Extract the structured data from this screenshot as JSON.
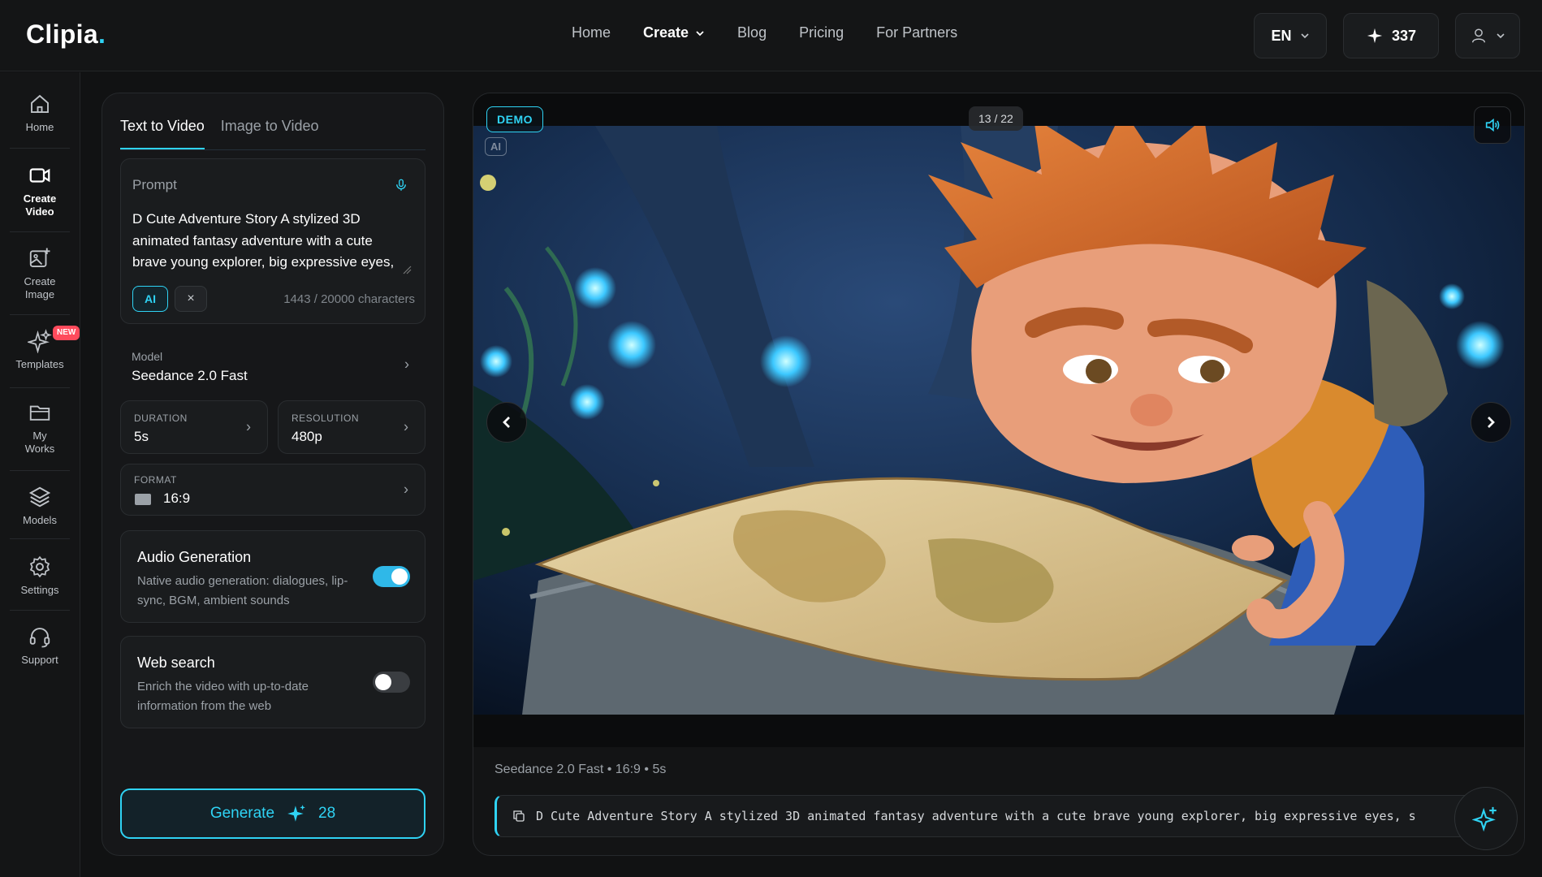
{
  "app": {
    "logo": "Clipia",
    "logo_dot": "."
  },
  "nav": {
    "items": [
      "Home",
      "Blog",
      "Pricing",
      "For Partners"
    ],
    "create_label": "Create"
  },
  "header": {
    "language": "EN",
    "credits": "337"
  },
  "sidebar": {
    "items": [
      {
        "label": "Home",
        "icon": "home-icon"
      },
      {
        "label": "Create\nVideo",
        "icon": "video-camera-icon"
      },
      {
        "label": "Create\nImage",
        "icon": "image-plus-icon"
      },
      {
        "label": "Templates",
        "icon": "sparkle-icon",
        "badge": "NEW"
      },
      {
        "label": "My\nWorks",
        "icon": "folder-icon"
      },
      {
        "label": "Models",
        "icon": "layers-icon"
      },
      {
        "label": "Settings",
        "icon": "gear-icon"
      },
      {
        "label": "Support",
        "icon": "headset-icon"
      }
    ]
  },
  "panel": {
    "tabs": [
      "Text to Video",
      "Image to Video"
    ],
    "prompt": {
      "label": "Prompt",
      "text": "D Cute Adventure Story A stylized 3D animated fantasy adventure with a cute brave young explorer, big expressive eyes, small backpack and colorful outfit, exploring",
      "ai_label": "AI",
      "clear_label": "×",
      "count": "1443 / 20000 characters"
    },
    "model": {
      "label": "Model",
      "value": "Seedance 2.0 Fast"
    },
    "duration": {
      "label": "DURATION",
      "value": "5s"
    },
    "resolution": {
      "label": "RESOLUTION",
      "value": "480p"
    },
    "format": {
      "label": "FORMAT",
      "value": "16:9"
    },
    "audio": {
      "title": "Audio Generation",
      "desc": "Native audio generation: dialogues, lip-sync, BGM, ambient sounds",
      "enabled": true
    },
    "web": {
      "title": "Web search",
      "desc": "Enrich the video with up-to-date information from the web",
      "enabled": false
    },
    "generate": {
      "label": "Generate",
      "cost": "28"
    }
  },
  "viewer": {
    "demo_label": "DEMO",
    "counter": "13 / 22",
    "watermark": "AI",
    "meta": "Seedance 2.0 Fast • 16:9 • 5s",
    "prompt_preview": "D Cute Adventure Story A stylized 3D animated fantasy adventure with a cute brave young explorer, big expressive eyes, s"
  },
  "colors": {
    "accent": "#2fd3f4",
    "background": "#111213",
    "panel": "#161719",
    "badge_new": "#ff4b5c"
  }
}
